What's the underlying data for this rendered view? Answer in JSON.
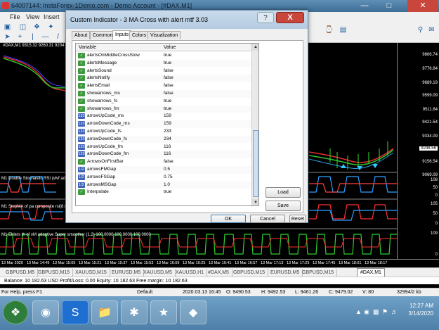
{
  "window": {
    "title": "64007144: InstaForex-1Demo.com - Demo Account - [#DAX,M1]"
  },
  "menu": {
    "items": [
      "File",
      "View",
      "Insert"
    ]
  },
  "chart": {
    "top_label": "#DAX,M1 9315.32 9260.31 9204",
    "price_labels": [
      "9866.74",
      "9776.64",
      "9689.19",
      "9599.09",
      "9511.64",
      "9421.54",
      "9334.09",
      "9248.56",
      "9156.54",
      "9069.09"
    ],
    "price_highlight": "9248.56",
    "subwindows": [
      {
        "label": "M1 Double Stochastic RSI (vlvf ada",
        "axis": [
          "108",
          "50",
          "0"
        ]
      },
      {
        "label": "M1 StepMA of pa composite rsi(8.0.0)",
        "axis": [
          "105",
          "50",
          "0"
        ]
      },
      {
        "label": "M1 Ehlers th of vM adaptive Super smoother (1.2) 100.0000 100.0000 100.0000",
        "axis": [
          "109",
          "0"
        ]
      }
    ],
    "time_labels": [
      "13 Mar 2020",
      "13 Mar 14:49",
      "13 Mar 15:05",
      "13 Mar 15:21",
      "13 Mar 15:37",
      "13 Mar 15:53",
      "13 Mar 16:09",
      "13 Mar 16:25",
      "13 Mar 16:41",
      "13 Mar 16:57",
      "13 Mar 17:13",
      "13 Mar 17:29",
      "13 Mar 17:45",
      "13 Mar 18:01",
      "13 Mar 18:17"
    ]
  },
  "tabs": [
    "GBPUSD,M5",
    "GBPUSD,M15",
    "XAUUSD,M15",
    "EURUSD,M5",
    "XAUUSD,M5",
    "XAUUSD,H1",
    "#DAX,M5",
    "GBPUSD,M15",
    "EURUSD,M5",
    "GBPUSD,M15",
    "#DAX,M1"
  ],
  "active_tab": "#DAX,M1",
  "balance": "Balance: 10 182.63 USD  Profit/Loss: 0.00  Equity: 10 182.63  Free margin: 10 182.63",
  "status": {
    "help": "For Help, press F1",
    "profile": "Default",
    "datetime": "2020.03.13 16:45",
    "open": "O: 9490.53",
    "high": "H: 9492.53",
    "low": "L: 9461.26",
    "close": "C: 9479.02",
    "volume": "V: 80",
    "traffic": "32994/2 kb"
  },
  "taskbar": {
    "time": "12:27 AM",
    "date": "3/14/2020"
  },
  "dialog": {
    "title": "Custom Indicator - 3 MA Cross with alert mtf 3.03",
    "help_label": "?",
    "close_label": "X",
    "tabs": [
      "About",
      "Common",
      "Inputs",
      "Colors",
      "Visualization"
    ],
    "active_tab": "Inputs",
    "col_variable": "Variable",
    "col_value": "Value",
    "rows": [
      {
        "type": "bool",
        "name": "alertsOnMiddleCrossSlow",
        "value": "true"
      },
      {
        "type": "bool",
        "name": "alertsMessage",
        "value": "true"
      },
      {
        "type": "bool",
        "name": "alertsSound",
        "value": "false"
      },
      {
        "type": "bool",
        "name": "alertsNotify",
        "value": "false"
      },
      {
        "type": "bool",
        "name": "alertsEmail",
        "value": "false"
      },
      {
        "type": "bool",
        "name": "showarrows_ms",
        "value": "false"
      },
      {
        "type": "bool",
        "name": "showarrows_fs",
        "value": "true"
      },
      {
        "type": "bool",
        "name": "showarrows_fm",
        "value": "true"
      },
      {
        "type": "int",
        "name": "arrowUpCode_ms",
        "value": "159"
      },
      {
        "type": "int",
        "name": "arrowDownCode_ms",
        "value": "159"
      },
      {
        "type": "int",
        "name": "arrowUpCode_fs",
        "value": "233"
      },
      {
        "type": "int",
        "name": "arrowDownCode_fs",
        "value": "234"
      },
      {
        "type": "int",
        "name": "arrowUpCode_fm",
        "value": "116"
      },
      {
        "type": "int",
        "name": "arrowDownCode_fm",
        "value": "116"
      },
      {
        "type": "bool",
        "name": "ArrowsOnFirstBar",
        "value": "false"
      },
      {
        "type": "dbl",
        "name": "arrowsFMGap",
        "value": "0.5"
      },
      {
        "type": "dbl",
        "name": "arrowsFSGap",
        "value": "0.75"
      },
      {
        "type": "dbl",
        "name": "arrowsMSGap",
        "value": "1.0"
      },
      {
        "type": "bool",
        "name": "Interpolate",
        "value": "true"
      }
    ],
    "load_label": "Load",
    "save_label": "Save",
    "ok_label": "OK",
    "cancel_label": "Cancel",
    "reset_label": "Reset"
  }
}
